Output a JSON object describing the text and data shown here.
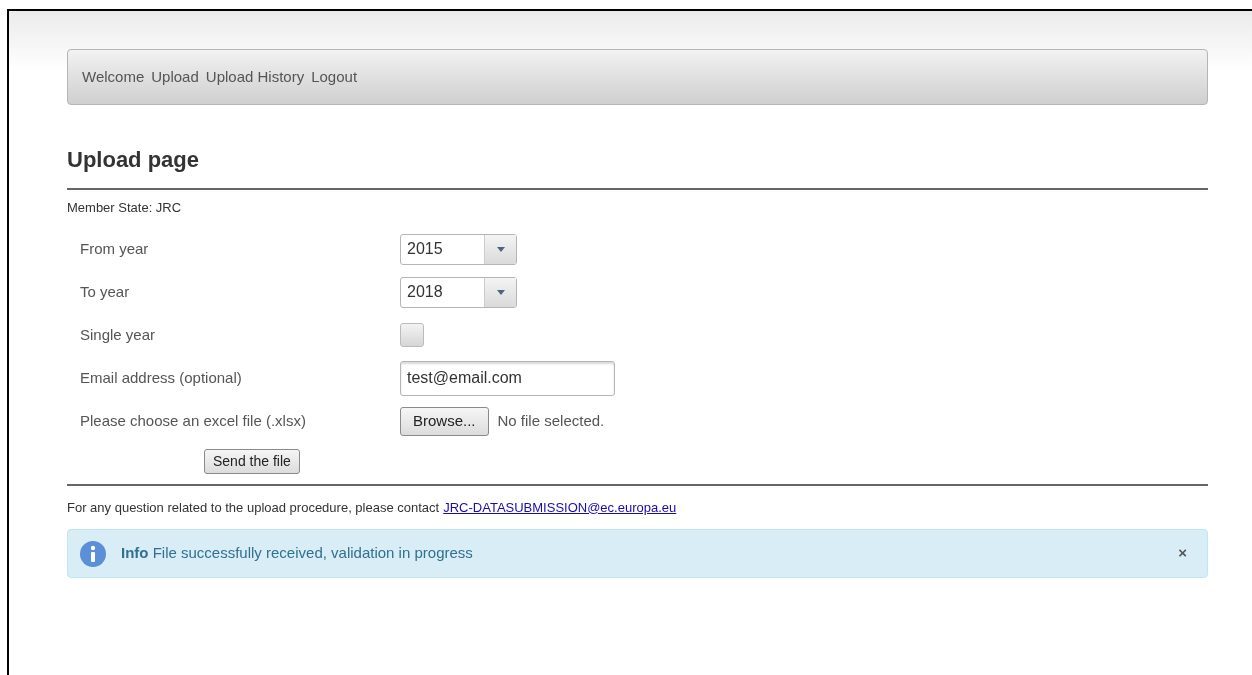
{
  "nav": [
    {
      "label": "Welcome"
    },
    {
      "label": "Upload"
    },
    {
      "label": "Upload History"
    },
    {
      "label": "Logout"
    }
  ],
  "heading": "Upload page",
  "member_state": "Member State: JRC",
  "form": [
    {
      "kind": "select",
      "label": "From year",
      "value": "2015"
    },
    {
      "kind": "select",
      "label": "To year",
      "value": "2018"
    },
    {
      "kind": "checkbox",
      "label": "Single year",
      "checked": false
    },
    {
      "kind": "text",
      "label": "Email address (optional)",
      "value": "test@email.com"
    },
    {
      "kind": "file",
      "label": "Please choose an excel file (.xlsx)",
      "button": "Browse...",
      "status": "No file selected."
    }
  ],
  "submit": "Send the file",
  "contact": {
    "text": "For any question related to the upload procedure, please contact",
    "link": "JRC-DATASUBMISSION@ec.europa.eu"
  },
  "alert": {
    "message": "**Info** File successfully received, validation in progress",
    "close": "×"
  }
}
